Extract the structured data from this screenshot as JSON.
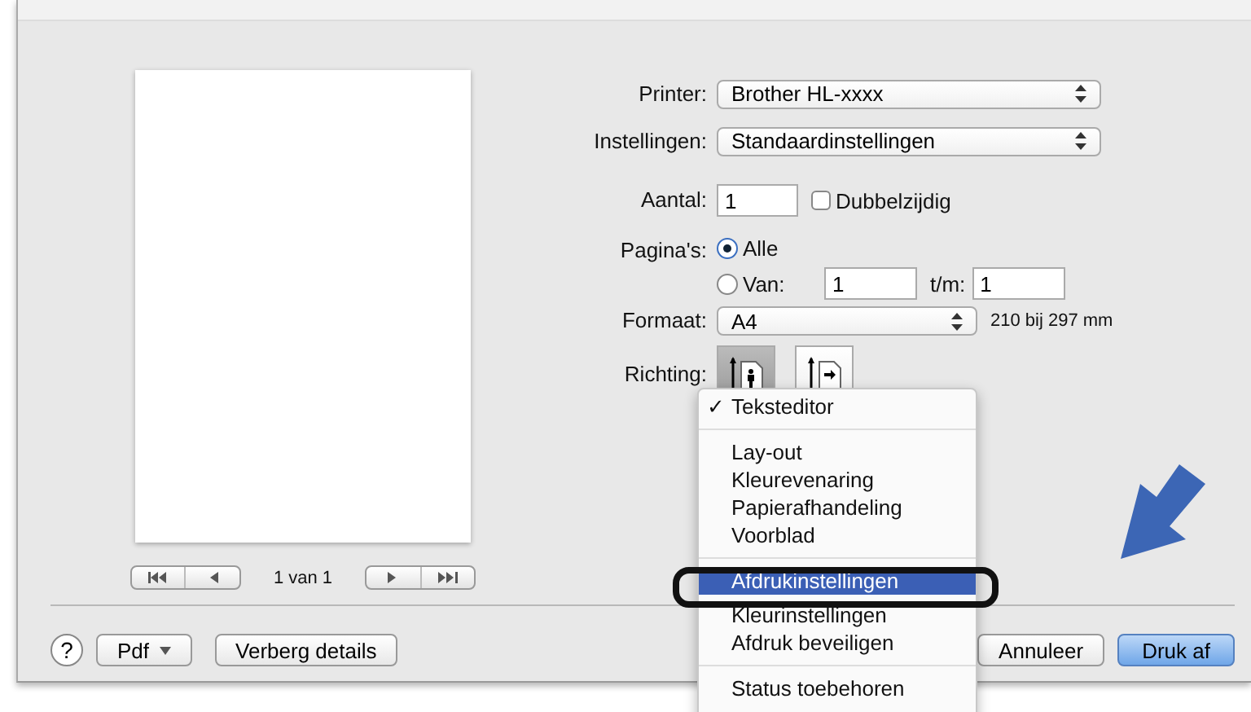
{
  "preview": {
    "pager": {
      "reading": "1 van 1"
    }
  },
  "form": {
    "printer": {
      "label": "Printer:",
      "value": "Brother HL-xxxx"
    },
    "settings": {
      "label": "Instellingen:",
      "value": "Standaardinstellingen"
    },
    "copies": {
      "label": "Aantal:",
      "value": "1",
      "duplex": {
        "label": "Dubbelzijdig",
        "checked": false
      }
    },
    "pages": {
      "label": "Pagina's:",
      "options": [
        {
          "label": "Alle",
          "selected": true
        },
        {
          "label": "Van:",
          "selected": false
        }
      ],
      "from": "1",
      "to_label": "t/m:",
      "to": "1"
    },
    "paper": {
      "label": "Formaat:",
      "value": "A4",
      "size": "210 bij 297 mm"
    },
    "orientation": {
      "label": "Richting:",
      "options": [
        {
          "kind": "portrait",
          "selected": true
        },
        {
          "kind": "landscape",
          "selected": false
        }
      ]
    }
  },
  "menu": {
    "check_mark": "✓",
    "groups": [
      [
        {
          "label": "Teksteditor",
          "checked": true,
          "selected": false
        }
      ],
      [
        {
          "label": "Lay-out",
          "checked": false,
          "selected": false
        },
        {
          "label": "Kleurevenaring",
          "checked": false,
          "selected": false
        },
        {
          "label": "Papierafhandeling",
          "checked": false,
          "selected": false
        },
        {
          "label": "Voorblad",
          "checked": false,
          "selected": false
        }
      ],
      [
        {
          "label": "Afdrukinstellingen",
          "checked": false,
          "selected": true
        },
        {
          "label": "Kleurinstellingen",
          "checked": false,
          "selected": false
        },
        {
          "label": "Afdruk beveiligen",
          "checked": false,
          "selected": false
        }
      ],
      [
        {
          "label": "Status toebehoren",
          "checked": false,
          "selected": false
        }
      ]
    ]
  },
  "footer": {
    "help": "?",
    "pdf": "Pdf",
    "hide_details": "Verberg details",
    "cancel": "Annuleer",
    "print": "Druk af"
  }
}
